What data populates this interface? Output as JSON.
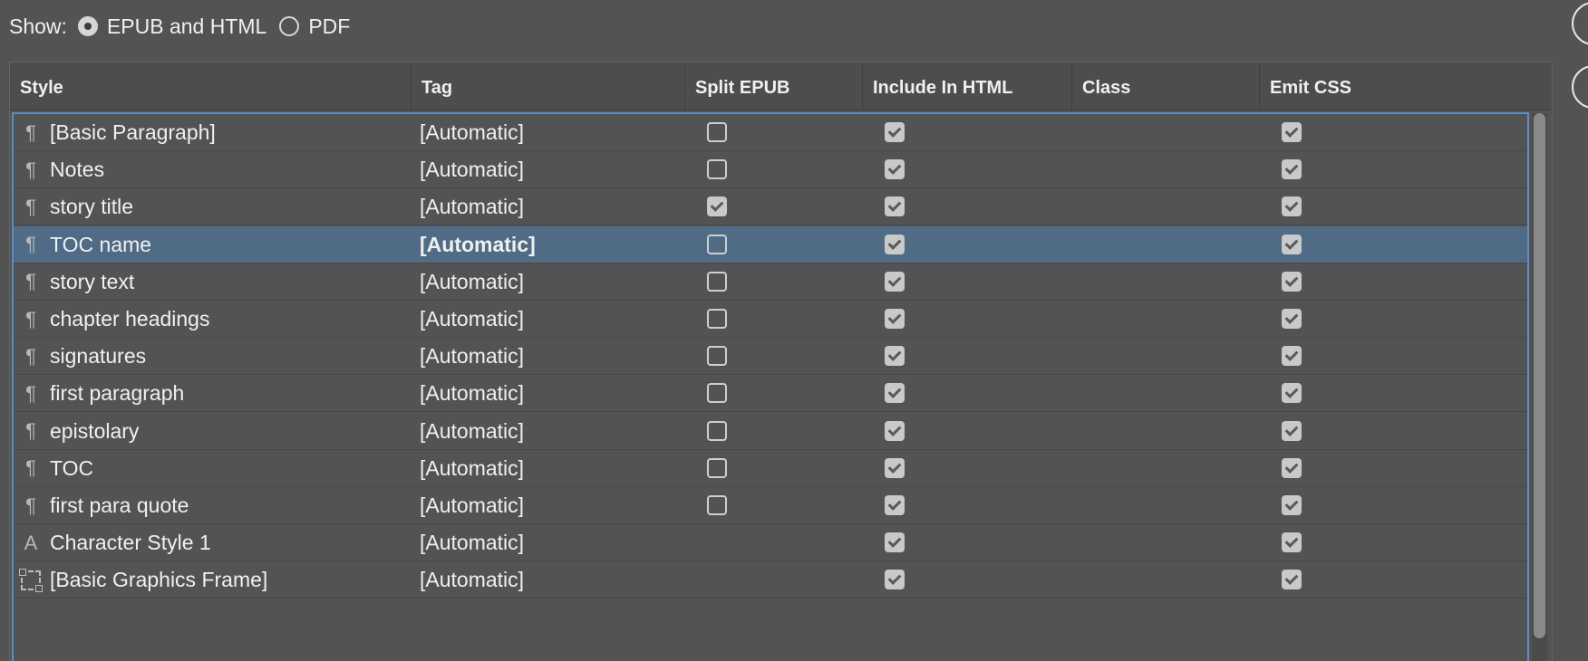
{
  "show": {
    "label": "Show:",
    "options": [
      {
        "label": "EPUB and HTML",
        "checked": true
      },
      {
        "label": "PDF",
        "checked": false
      }
    ]
  },
  "table": {
    "headers": [
      "Style",
      "Tag",
      "Split EPUB",
      "Include In HTML",
      "Class",
      "Emit CSS"
    ],
    "rows": [
      {
        "icon": "paragraph-style-icon",
        "style": "[Basic Paragraph]",
        "tag": "[Automatic]",
        "split_epub": false,
        "include_html": true,
        "class": "",
        "emit_css": true
      },
      {
        "icon": "paragraph-style-icon",
        "style": "Notes",
        "tag": "[Automatic]",
        "split_epub": false,
        "include_html": true,
        "class": "",
        "emit_css": true
      },
      {
        "icon": "paragraph-style-icon",
        "style": "story title",
        "tag": "[Automatic]",
        "split_epub": true,
        "include_html": true,
        "class": "",
        "emit_css": true
      },
      {
        "icon": "paragraph-style-icon",
        "style": "TOC name",
        "tag": "[Automatic]",
        "split_epub": false,
        "include_html": true,
        "class": "",
        "emit_css": true,
        "selected": true
      },
      {
        "icon": "paragraph-style-icon",
        "style": "story text",
        "tag": "[Automatic]",
        "split_epub": false,
        "include_html": true,
        "class": "",
        "emit_css": true
      },
      {
        "icon": "paragraph-style-icon",
        "style": "chapter headings",
        "tag": "[Automatic]",
        "split_epub": false,
        "include_html": true,
        "class": "",
        "emit_css": true
      },
      {
        "icon": "paragraph-style-icon",
        "style": "signatures",
        "tag": "[Automatic]",
        "split_epub": false,
        "include_html": true,
        "class": "",
        "emit_css": true
      },
      {
        "icon": "paragraph-style-icon",
        "style": "first paragraph",
        "tag": "[Automatic]",
        "split_epub": false,
        "include_html": true,
        "class": "",
        "emit_css": true
      },
      {
        "icon": "paragraph-style-icon",
        "style": "epistolary",
        "tag": "[Automatic]",
        "split_epub": false,
        "include_html": true,
        "class": "",
        "emit_css": true
      },
      {
        "icon": "paragraph-style-icon",
        "style": "TOC",
        "tag": "[Automatic]",
        "split_epub": false,
        "include_html": true,
        "class": "",
        "emit_css": true
      },
      {
        "icon": "paragraph-style-icon",
        "style": "first para quote",
        "tag": "[Automatic]",
        "split_epub": false,
        "include_html": true,
        "class": "",
        "emit_css": true
      },
      {
        "icon": "character-style-icon",
        "style": "Character Style 1",
        "tag": "[Automatic]",
        "split_epub": null,
        "include_html": true,
        "class": "",
        "emit_css": true
      },
      {
        "icon": "graphics-frame-icon",
        "style": "[Basic Graphics Frame]",
        "tag": "[Automatic]",
        "split_epub": null,
        "include_html": true,
        "class": "",
        "emit_css": true
      }
    ]
  }
}
